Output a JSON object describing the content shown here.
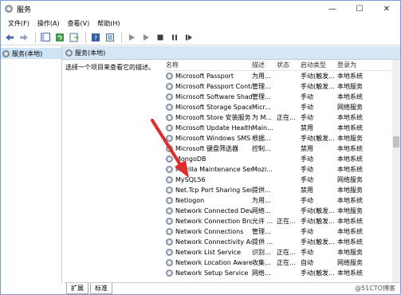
{
  "window": {
    "title": "服务",
    "minimize": "—",
    "maximize": "☐",
    "close": "✕"
  },
  "menu": [
    "文件(F)",
    "操作(A)",
    "查看(V)",
    "帮助(H)"
  ],
  "tree": {
    "item": "服务(本地)"
  },
  "pane": {
    "header": "服务(本地)",
    "description": "选择一个项目来查看它的描述。"
  },
  "columns": {
    "name": "名称",
    "desc": "描述",
    "status": "状态",
    "start": "启动类型",
    "logon": "登录为"
  },
  "rows": [
    {
      "name": "Microsoft Passport",
      "desc": "为用...",
      "status": "",
      "start": "手动(触发...",
      "logon": "本地系统"
    },
    {
      "name": "Microsoft Passport Container",
      "desc": "管理...",
      "status": "",
      "start": "手动(触发...",
      "logon": "本地服务"
    },
    {
      "name": "Microsoft Software Shado...",
      "desc": "管理...",
      "status": "",
      "start": "手动",
      "logon": "本地系统"
    },
    {
      "name": "Microsoft Storage Spaces S...",
      "desc": "Micr...",
      "status": "",
      "start": "手动",
      "logon": "网络服务"
    },
    {
      "name": "Microsoft Store 安装服务",
      "desc": "为 M...",
      "status": "正在...",
      "start": "手动",
      "logon": "本地系统"
    },
    {
      "name": "Microsoft Update Health S...",
      "desc": "Main...",
      "status": "",
      "start": "禁用",
      "logon": "本地系统"
    },
    {
      "name": "Microsoft Windows SMS 路...",
      "desc": "根据...",
      "status": "",
      "start": "手动(触发...",
      "logon": "本地服务"
    },
    {
      "name": "Microsoft 键盘筛选器",
      "desc": "控制...",
      "status": "",
      "start": "禁用",
      "logon": "本地系统"
    },
    {
      "name": "MongoDB",
      "desc": "",
      "status": "",
      "start": "手动",
      "logon": "本地系统"
    },
    {
      "name": "Mozilla Maintenance Service",
      "desc": "Mozi...",
      "status": "",
      "start": "手动",
      "logon": "本地系统"
    },
    {
      "name": "MySQL56",
      "desc": "",
      "status": "",
      "start": "手动",
      "logon": "网络服务"
    },
    {
      "name": "Net.Tcp Port Sharing Service",
      "desc": "提供...",
      "status": "",
      "start": "禁用",
      "logon": "本地服务"
    },
    {
      "name": "Netlogon",
      "desc": "为用...",
      "status": "",
      "start": "手动",
      "logon": "本地系统"
    },
    {
      "name": "Network Connected Devic...",
      "desc": "网络...",
      "status": "",
      "start": "手动(触发...",
      "logon": "本地服务"
    },
    {
      "name": "Network Connection Broker",
      "desc": "允许 ...",
      "status": "正在...",
      "start": "手动(触发...",
      "logon": "本地系统"
    },
    {
      "name": "Network Connections",
      "desc": "管理...",
      "status": "",
      "start": "手动",
      "logon": "本地系统"
    },
    {
      "name": "Network Connectivity Assis...",
      "desc": "提供 ...",
      "status": "",
      "start": "手动(触发...",
      "logon": "本地系统"
    },
    {
      "name": "Network List Service",
      "desc": "识别...",
      "status": "正在...",
      "start": "手动",
      "logon": "本地服务"
    },
    {
      "name": "Network Location Awarene...",
      "desc": "收集...",
      "status": "正在...",
      "start": "自动",
      "logon": "网络服务"
    },
    {
      "name": "Network Setup Service",
      "desc": "网络...",
      "status": "",
      "start": "手动(触发...",
      "logon": "本地系统"
    }
  ],
  "tabs": [
    "扩展",
    "标准"
  ],
  "watermark": "@51CTO博客"
}
